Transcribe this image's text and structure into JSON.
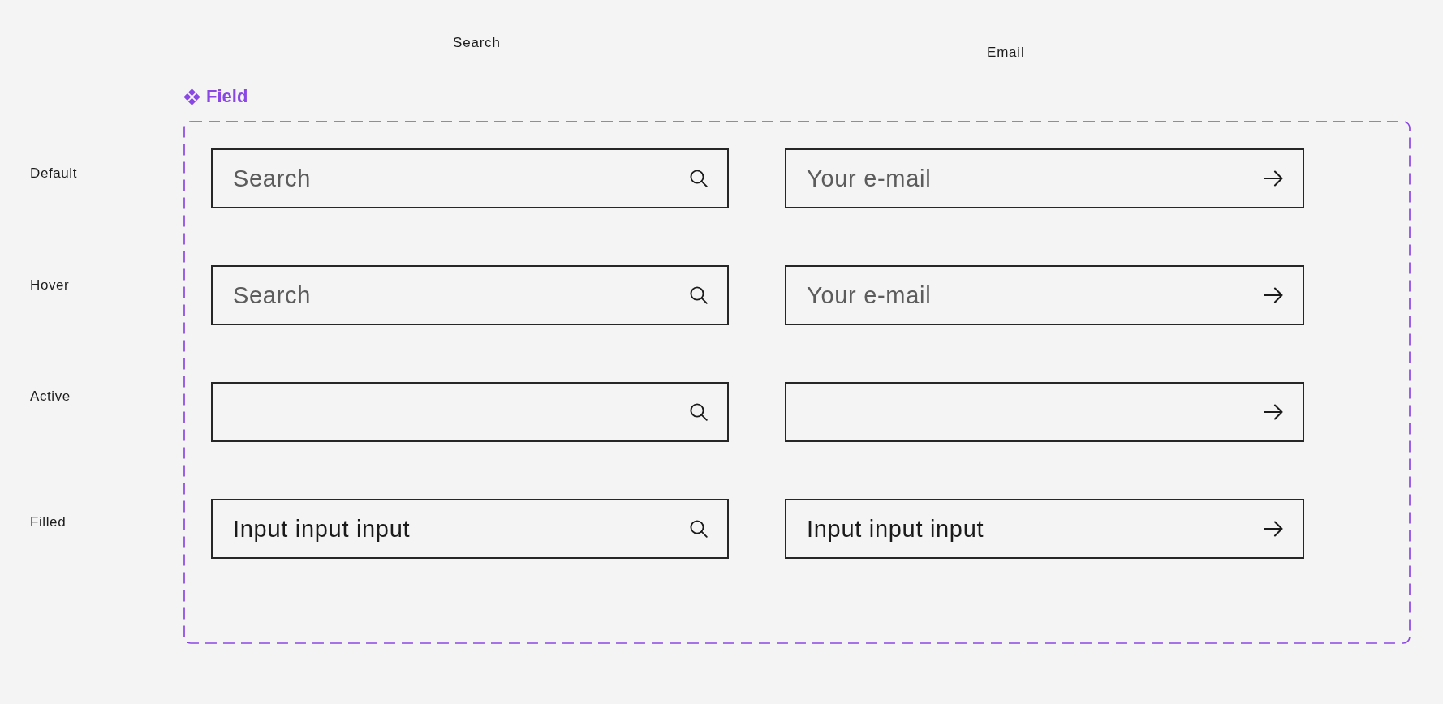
{
  "columns": [
    {
      "label": "Search"
    },
    {
      "label": "Email"
    }
  ],
  "component": {
    "title": "Field"
  },
  "rows": [
    {
      "label": "Default",
      "fields": [
        {
          "kind": "search",
          "placeholder": "Search"
        },
        {
          "kind": "email",
          "placeholder": "Your e-mail"
        }
      ]
    },
    {
      "label": "Hover",
      "fields": [
        {
          "kind": "search",
          "placeholder": "Search"
        },
        {
          "kind": "email",
          "placeholder": "Your e-mail"
        }
      ]
    },
    {
      "label": "Active",
      "fields": [
        {
          "kind": "search"
        },
        {
          "kind": "email"
        }
      ]
    },
    {
      "label": "Filled",
      "fields": [
        {
          "kind": "search",
          "value": "Input input input"
        },
        {
          "kind": "email",
          "value": "Input input input"
        }
      ]
    }
  ]
}
